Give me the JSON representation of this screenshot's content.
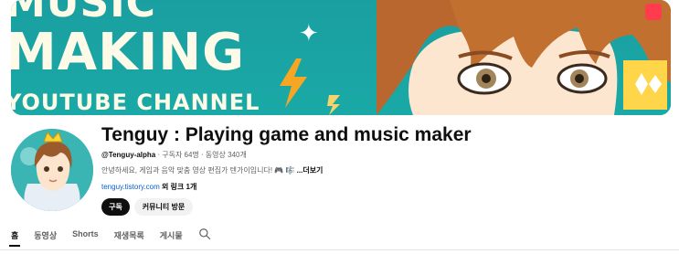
{
  "banner": {
    "line1": "MUSIC",
    "line2": "MAKING",
    "line3": "YOUTUBE CHANNEL"
  },
  "channel": {
    "title": "Tenguy : Playing game and music maker",
    "handle": "@Tenguy-alpha",
    "subscribers": "구독자 64명",
    "videos": "동영상 340개",
    "separator": "‧",
    "description": "안녕하세요, 게임과 음악 맞춤 영상 편집가 텐가이입니다! 🎮 🎼",
    "more_label": "...더보기",
    "link_url": "tenguy.tistory.com",
    "link_extra": "외 링크 1개",
    "subscribe_label": "구독",
    "community_label": "커뮤니티 방문"
  },
  "tabs": [
    {
      "label": "홈",
      "active": true
    },
    {
      "label": "동영상",
      "active": false
    },
    {
      "label": "Shorts",
      "active": false
    },
    {
      "label": "재생목록",
      "active": false
    },
    {
      "label": "게시물",
      "active": false
    }
  ],
  "icons": {
    "tab_search": "search-icon",
    "banner_sparkle": "sparkle-icon",
    "banner_bolt": "lightning-bolt-icon"
  },
  "colors": {
    "banner_bg": "#1aa6a4",
    "banner_text": "#fdfbe8",
    "subscribe_bg": "#0f0f0f",
    "link": "#065fd4"
  }
}
